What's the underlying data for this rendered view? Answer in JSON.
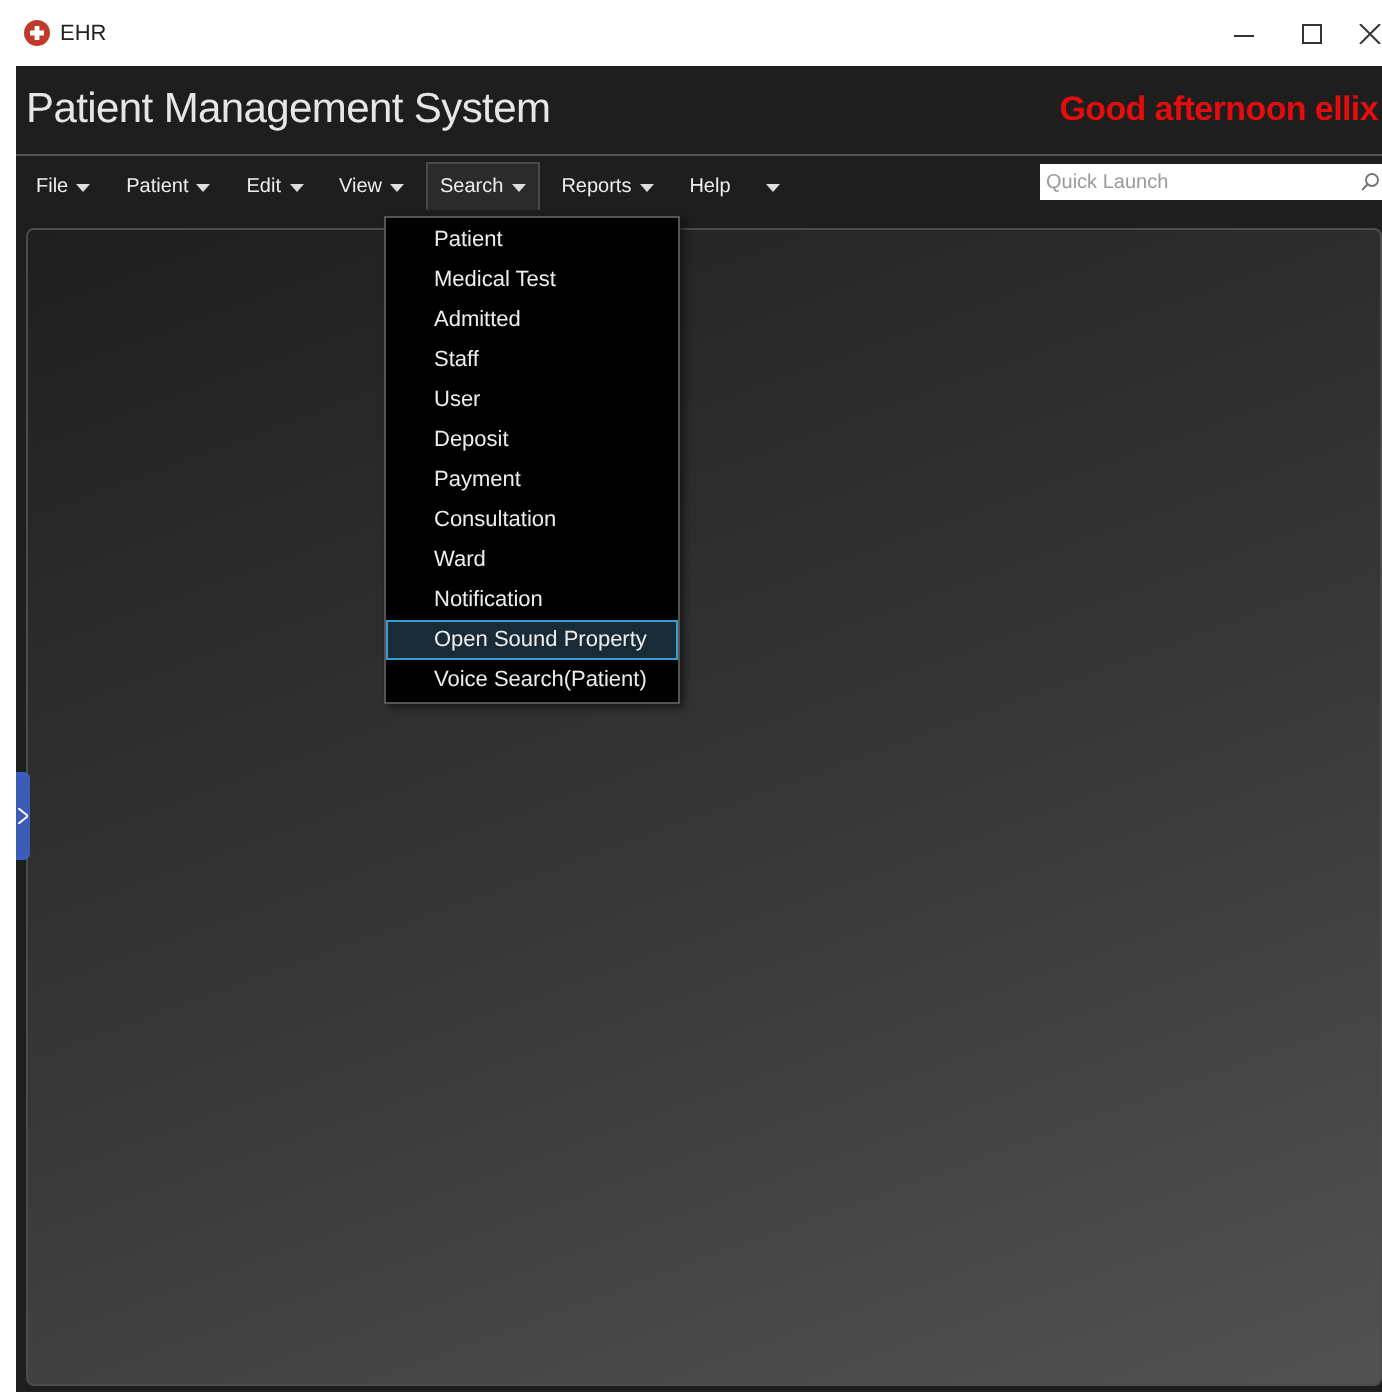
{
  "window": {
    "title": "EHR"
  },
  "app": {
    "title": "Patient Management System",
    "greeting": "Good afternoon ellix"
  },
  "menu": [
    {
      "label": "File",
      "selected": false,
      "caret": true
    },
    {
      "label": "Patient",
      "selected": false,
      "caret": true
    },
    {
      "label": "Edit",
      "selected": false,
      "caret": true
    },
    {
      "label": "View",
      "selected": false,
      "caret": true
    },
    {
      "label": "Search",
      "selected": true,
      "caret": true
    },
    {
      "label": "Reports",
      "selected": false,
      "caret": true
    },
    {
      "label": "Help",
      "selected": false,
      "caret": false
    }
  ],
  "quick_launch": {
    "placeholder": "Quick Launch"
  },
  "dropdown": [
    {
      "label": "Patient",
      "selected": false
    },
    {
      "label": "Medical Test",
      "selected": false
    },
    {
      "label": "Admitted",
      "selected": false
    },
    {
      "label": "Staff",
      "selected": false
    },
    {
      "label": "User",
      "selected": false
    },
    {
      "label": "Deposit",
      "selected": false
    },
    {
      "label": "Payment",
      "selected": false
    },
    {
      "label": "Consultation",
      "selected": false
    },
    {
      "label": "Ward",
      "selected": false
    },
    {
      "label": "Notification",
      "selected": false
    },
    {
      "label": "Open Sound Property",
      "selected": true
    },
    {
      "label": "Voice Search(Patient)",
      "selected": false
    }
  ]
}
